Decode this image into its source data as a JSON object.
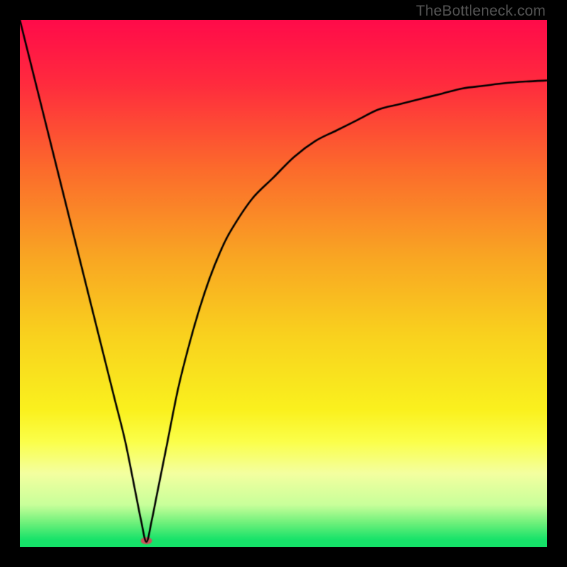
{
  "watermark": "TheBottleneck.com",
  "chart_data": {
    "type": "line",
    "title": "",
    "xlabel": "",
    "ylabel": "",
    "xlim": [
      0,
      100
    ],
    "ylim": [
      0,
      100
    ],
    "gradient_stops": [
      {
        "pos": 0.0,
        "color": "#ff0b4a"
      },
      {
        "pos": 0.12,
        "color": "#ff2b3e"
      },
      {
        "pos": 0.28,
        "color": "#fc6a2c"
      },
      {
        "pos": 0.45,
        "color": "#f9a623"
      },
      {
        "pos": 0.6,
        "color": "#f9d21e"
      },
      {
        "pos": 0.74,
        "color": "#faf11e"
      },
      {
        "pos": 0.8,
        "color": "#fbff4a"
      },
      {
        "pos": 0.86,
        "color": "#f4ffa0"
      },
      {
        "pos": 0.92,
        "color": "#c8ff9a"
      },
      {
        "pos": 0.955,
        "color": "#6bf07a"
      },
      {
        "pos": 0.985,
        "color": "#19e36a"
      },
      {
        "pos": 1.0,
        "color": "#14e268"
      }
    ],
    "minimum_marker": {
      "x": 24,
      "y": 1.2,
      "color": "#c9555a",
      "rx": 8,
      "ry": 5
    },
    "series": [
      {
        "name": "bottleneck-curve",
        "x": [
          0,
          2,
          4,
          6,
          8,
          10,
          12,
          14,
          16,
          18,
          20,
          22,
          23,
          24,
          25,
          26,
          28,
          30,
          32,
          34,
          36,
          38,
          40,
          44,
          48,
          52,
          56,
          60,
          64,
          68,
          72,
          76,
          80,
          84,
          88,
          92,
          96,
          100
        ],
        "y": [
          100,
          92,
          84,
          76,
          68,
          60,
          52,
          44,
          36,
          28,
          20,
          10,
          5,
          1,
          5,
          10,
          20,
          30,
          38,
          45,
          51,
          56,
          60,
          66,
          70,
          74,
          77,
          79,
          81,
          83,
          84,
          85,
          86,
          87,
          87.5,
          88,
          88.3,
          88.5
        ]
      }
    ]
  }
}
